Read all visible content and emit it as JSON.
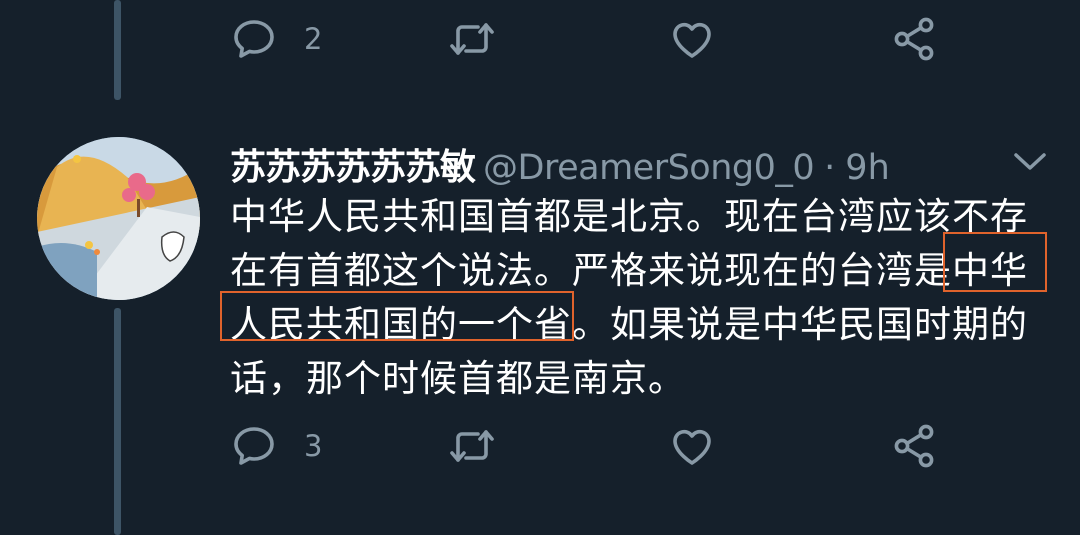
{
  "colors": {
    "background": "#15202b",
    "thread_line": "#3d5466",
    "icon": "#8899a6",
    "text": "#ffffff",
    "secondary_text": "#8899a6",
    "highlight_box": "#e0632c"
  },
  "previous_tweet": {
    "actions": {
      "reply": {
        "icon": "reply-icon",
        "count": "2"
      },
      "retweet": {
        "icon": "retweet-icon"
      },
      "like": {
        "icon": "like-icon"
      },
      "share": {
        "icon": "share-icon"
      }
    }
  },
  "tweet": {
    "display_name": "苏苏苏苏苏苏敏",
    "handle": "@DreamerSong0_0",
    "separator": "·",
    "time": "9h",
    "text_lines": {
      "l1": "中华人民共和国首都是北京。现在台湾应该不存",
      "l2_before": "在有首都这个说法。严格来说现在的台湾是",
      "l2_hl": "中华",
      "l3_hl": "人民共和国的一个省",
      "l3_after": "。如果说是中华民国时期的",
      "l4": "话，那个时候首都是南京。"
    },
    "actions": {
      "reply": {
        "icon": "reply-icon",
        "count": "3"
      },
      "retweet": {
        "icon": "retweet-icon"
      },
      "like": {
        "icon": "like-icon"
      },
      "share": {
        "icon": "share-icon"
      }
    },
    "menu_icon": "chevron-down-icon"
  }
}
